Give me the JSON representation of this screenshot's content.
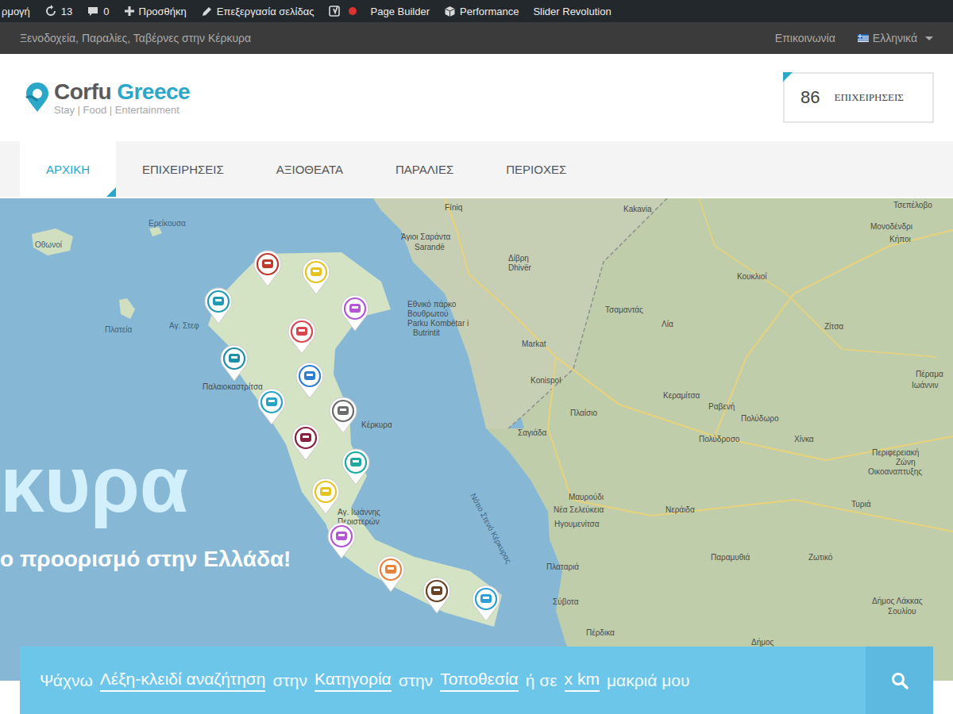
{
  "admin_bar": {
    "items": [
      {
        "kind": "text",
        "label": "ρμογή"
      },
      {
        "kind": "updates",
        "label": "13"
      },
      {
        "kind": "comments",
        "label": "0"
      },
      {
        "kind": "new",
        "label": "Προσθήκη"
      },
      {
        "kind": "edit",
        "label": "Επεξεργασία σελίδας"
      },
      {
        "kind": "seo",
        "status_color": "#dc3232"
      },
      {
        "kind": "text",
        "label": "Page Builder"
      },
      {
        "kind": "performance",
        "label": "Performance"
      },
      {
        "kind": "text",
        "label": "Slider Revolution"
      }
    ]
  },
  "top_bar": {
    "tagline": "Ξενοδοχεία, Παραλίες, Ταβέρνες στην Κέρκυρα",
    "contact": "Επικοινωνία",
    "language": "Ελληνικά"
  },
  "header": {
    "logo": {
      "first": "Corfu",
      "second": "Greece",
      "tagline": "Stay | Food | Entertainment"
    },
    "counter": {
      "value": "86",
      "label": "ΕΠΙΧΕΙΡΗΣΕΙΣ"
    }
  },
  "nav": [
    {
      "label": "ΑΡΧΙΚΗ",
      "selected": true
    },
    {
      "label": "ΕΠΙΧΕΙΡΗΣΕΙΣ",
      "selected": false
    },
    {
      "label": "ΑΞΙΟΘΕΑΤΑ",
      "selected": false
    },
    {
      "label": "ΠΑΡΑΛΙΕΣ",
      "selected": false
    },
    {
      "label": "ΠΕΡΙΟΧΕΣ",
      "selected": false
    }
  ],
  "hero": {
    "title": "κυρα",
    "subtitle": "ο προορισμό στην Ελλάδα!"
  },
  "map": {
    "labels": [
      "Ερείκουσα",
      "Οθωνοί",
      "Πλατεία",
      "Αγ. Στεφ",
      "Παλαιοκαστρίτσα",
      "Κέρκυρα",
      "Αγ. Ιωάννης",
      "Περιστερών",
      "Fíniq",
      "Kakavia",
      "Άγιοι Σαράντα",
      "Sarandë",
      "Δίβρη",
      "Dhivër",
      "Εθνικό πάρκο",
      "Βουθρωτού",
      "Parku Kombëtar i",
      "Butrintit",
      "Markat",
      "Τσαμαντάς",
      "Λία",
      "Κουκλιοί",
      "Ζίτσα",
      "Konispol",
      "Κεραμίτσα",
      "Ραβενή",
      "Πολύδωρο",
      "Πολύδροσο",
      "Χίνκα",
      "Πλαίσιο",
      "Σαγιάδα",
      "Περιφερειακή",
      "Ζώνη",
      "Οικοαναπτυξης",
      "Μαυρούδι",
      "Νέα Σελεύκεια",
      "Ηγουμενίτσα",
      "Νεράιδα",
      "Τυριά",
      "Παραμυθιά",
      "Ζωτικό",
      "Πλαταριά",
      "Σύβοτα",
      "Πέρδικα",
      "Δήμος Λάκκας",
      "Σουλίου",
      "Δήμος",
      "Πέραμα",
      "Ιωάννιν",
      "Μονοδένδρι",
      "Κήποι",
      "Τσεπέλοβο",
      "Νότιο Στενό Κέρκυρας"
    ],
    "pins": [
      {
        "color": "#c0392b"
      },
      {
        "color": "#e6c41f"
      },
      {
        "color": "#b455d6"
      },
      {
        "color": "#1f9bb5"
      },
      {
        "color": "#d9454f"
      },
      {
        "color": "#1f8fa8"
      },
      {
        "color": "#2f7fd0"
      },
      {
        "color": "#27a3c6"
      },
      {
        "color": "#6b6b6b"
      },
      {
        "color": "#8a1f3d"
      },
      {
        "color": "#1fa8a0"
      },
      {
        "color": "#e6c41f"
      },
      {
        "color": "#b455d6"
      },
      {
        "color": "#e8823a"
      },
      {
        "color": "#6b3f22"
      },
      {
        "color": "#2b9fd6"
      }
    ]
  },
  "search": {
    "parts": [
      {
        "kind": "word",
        "text": "Ψάχνω"
      },
      {
        "kind": "field",
        "text": "Λέξη-κλειδί αναζήτηση"
      },
      {
        "kind": "word",
        "text": "στην"
      },
      {
        "kind": "field",
        "text": "Κατηγορία"
      },
      {
        "kind": "word",
        "text": "στην"
      },
      {
        "kind": "field",
        "text": "Τοποθεσία"
      },
      {
        "kind": "word",
        "text": "ή σε"
      },
      {
        "kind": "field",
        "text": "x km"
      },
      {
        "kind": "word",
        "text": "μακριά μου"
      }
    ]
  }
}
